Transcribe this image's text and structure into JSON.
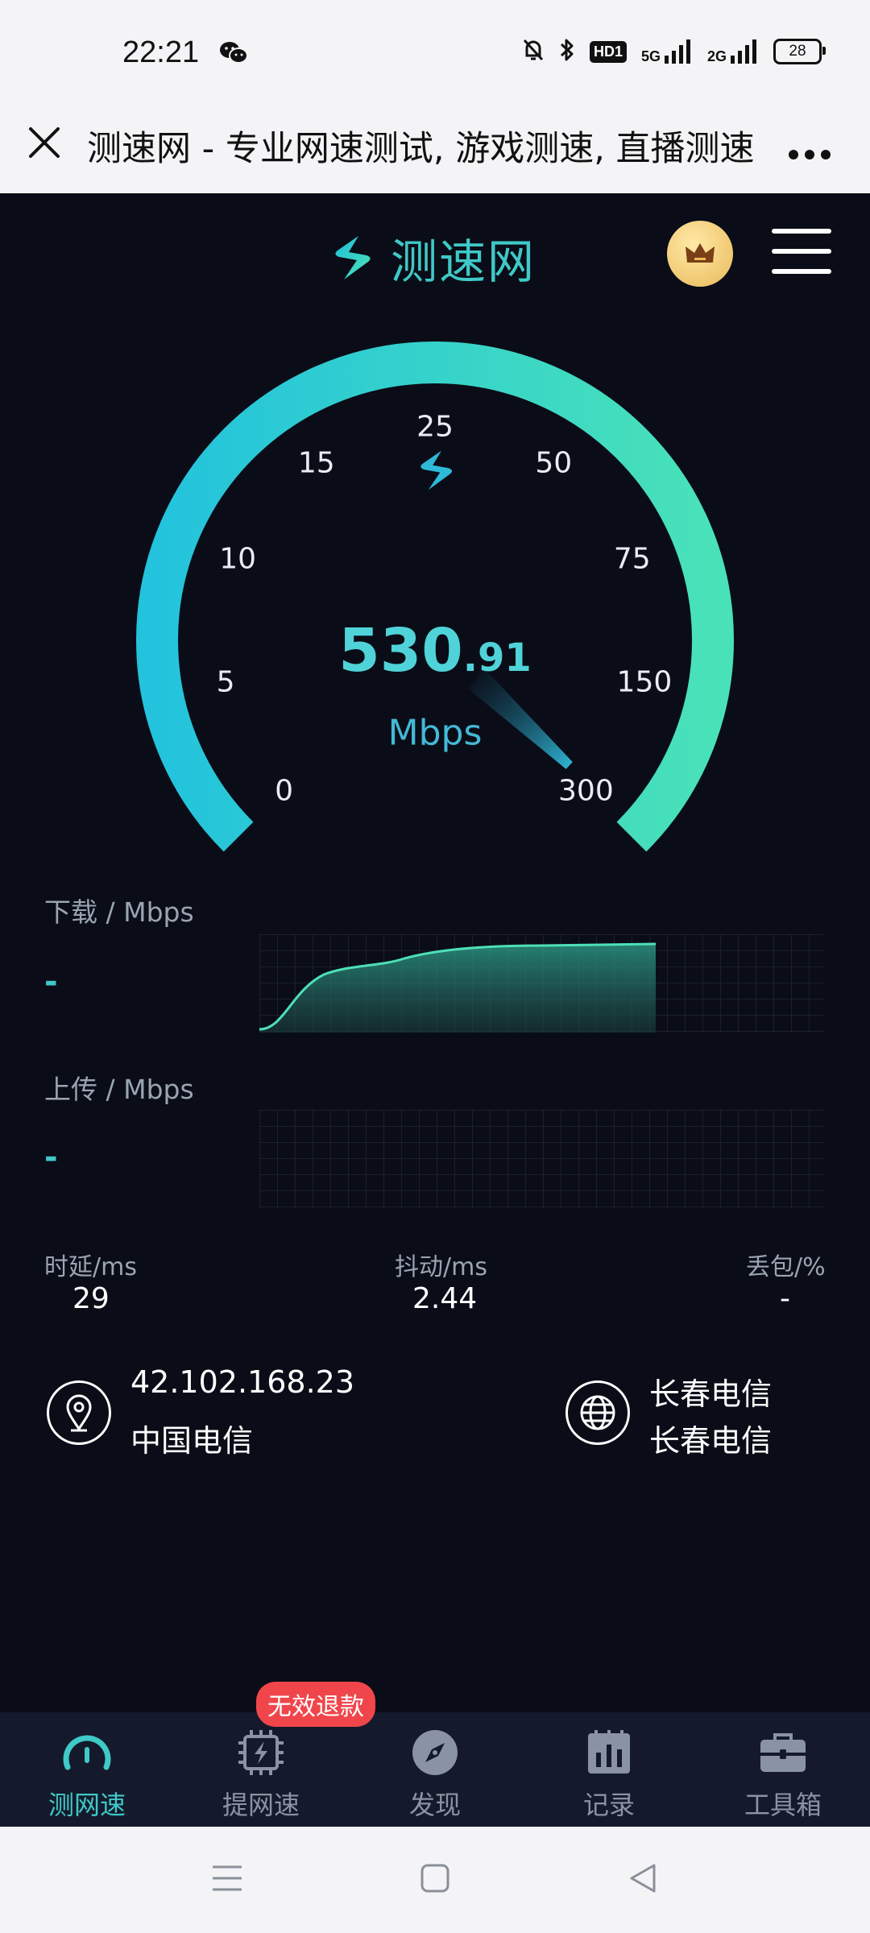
{
  "status_bar": {
    "time": "22:21",
    "network_5g": "5G",
    "network_2g": "2G",
    "battery": "28",
    "hd_label": "HD1"
  },
  "browser": {
    "title": "测速网 - 专业网速测试, 游戏测速, 直播测速"
  },
  "app": {
    "logo_text": "测速网"
  },
  "gauge": {
    "ticks": [
      "0",
      "5",
      "10",
      "15",
      "25",
      "50",
      "75",
      "150",
      "300"
    ],
    "speed_integer": "530",
    "speed_decimal": ".91",
    "unit": "Mbps",
    "needle_value": 530.91
  },
  "download": {
    "label": "下载 / Mbps",
    "value": "-"
  },
  "upload": {
    "label": "上传 / Mbps",
    "value": "-"
  },
  "stats": {
    "latency_label": "时延/ms",
    "latency_value": "29",
    "jitter_label": "抖动/ms",
    "jitter_value": "2.44",
    "loss_label": "丢包/%",
    "loss_value": "-"
  },
  "network": {
    "ip": "42.102.168.23",
    "isp": "中国电信",
    "server_line1": "长春电信",
    "server_line2": "长春电信"
  },
  "nav": {
    "items": [
      {
        "label": "测网速",
        "icon": "speedometer-icon",
        "active": true
      },
      {
        "label": "提网速",
        "icon": "chip-bolt-icon",
        "active": false
      },
      {
        "label": "发现",
        "icon": "compass-icon",
        "active": false
      },
      {
        "label": "记录",
        "icon": "bar-chart-icon",
        "active": false
      },
      {
        "label": "工具箱",
        "icon": "toolbox-icon",
        "active": false
      }
    ],
    "badge": "无效退款"
  },
  "colors": {
    "background": "#0a0d17",
    "accent": "#3fc9c8",
    "gauge_start": "#23c3dd",
    "gauge_end": "#49e2b8",
    "badge": "#f0464b"
  }
}
